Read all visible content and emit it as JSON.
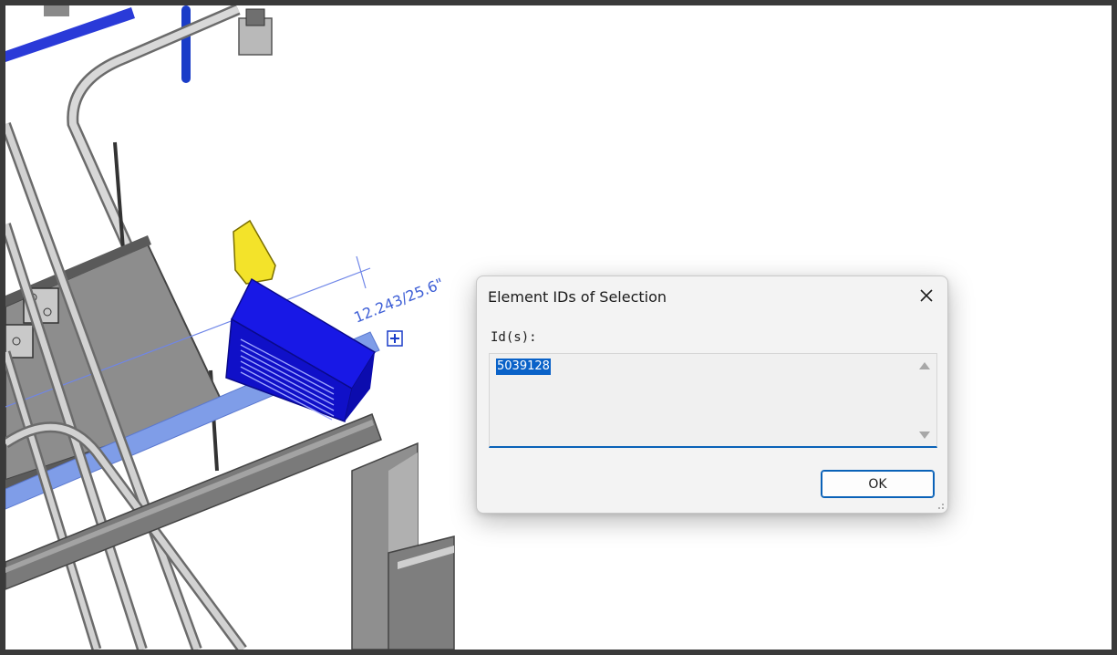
{
  "viewport": {
    "dimension_text": "12.243/25.6\""
  },
  "dialog": {
    "title": "Element IDs of Selection",
    "field_label": "Id(s):",
    "ids_value": "5039128",
    "ok_label": "OK"
  },
  "icons": {
    "close": "close-icon",
    "scroll_up": "scroll-up-arrow-icon",
    "scroll_down": "scroll-down-arrow-icon",
    "resize": "resize-grip-icon",
    "move": "move-handle-icon"
  },
  "colors": {
    "selected_element": "#1818e6",
    "pipe_highlight": "#7f9de8",
    "accent": "#0a62b8",
    "annotation": "#3e5fd6",
    "lamp": "#f3e32a"
  }
}
